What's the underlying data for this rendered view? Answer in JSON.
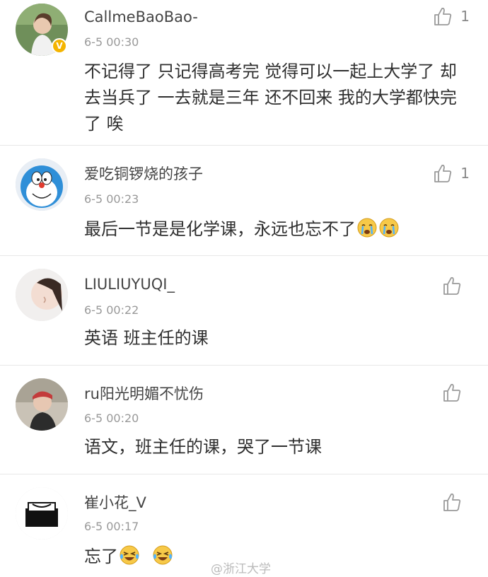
{
  "comments": [
    {
      "username": "CallmeBaoBao-",
      "time": "6-5 00:30",
      "text": "不记得了 只记得高考完 觉得可以一起上大学了 却去当兵了 一去就是三年 还不回来 我的大学都快完了 唉",
      "likes": "1",
      "verified_badge": "V"
    },
    {
      "username": "爱吃铜锣烧的孩子",
      "time": "6-5 00:23",
      "text": "最后一节是是化学课，永远也忘不了",
      "likes": "1",
      "emoji": [
        "crying-face-icon",
        "crying-face-icon"
      ]
    },
    {
      "username": "LIULIUYUQI_",
      "time": "6-5 00:22",
      "text": "英语 班主任的课",
      "likes": ""
    },
    {
      "username": "ru阳光明媚不忧伤",
      "time": "6-5 00:20",
      "text": "语文，班主任的课，哭了一节课",
      "likes": ""
    },
    {
      "username": "崔小花_V",
      "time": "6-5 00:17",
      "text": "忘了",
      "likes": "",
      "emoji": [
        "laughing-tears-icon",
        "laughing-tears-icon"
      ]
    }
  ],
  "watermark": "@浙江大学",
  "colors": {
    "username": "#444444",
    "time": "#999999",
    "separator": "#e7e7e7",
    "badge": "#f4b400",
    "emoji": "#f7c948"
  }
}
